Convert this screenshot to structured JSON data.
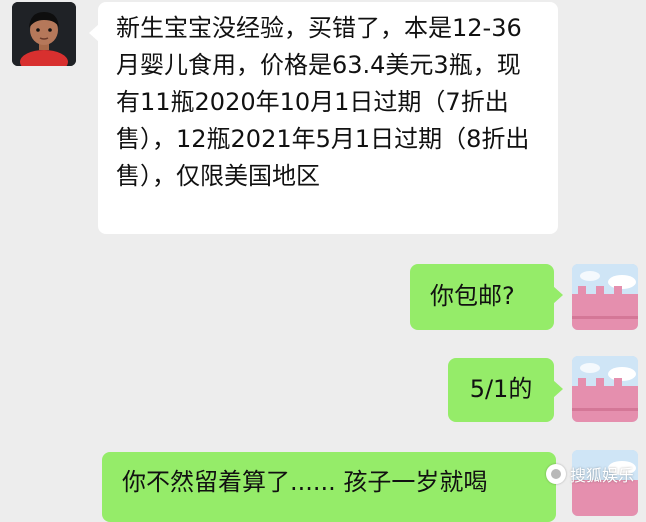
{
  "chat": {
    "messages": [
      {
        "sender": "other",
        "text": "新生宝宝没经验，买错了，本是12-36月婴儿食用，价格是63.4美元3瓶，现有11瓶2020年10月1日过期（7折出售），12瓶2021年5月1日过期（8折出售），仅限美国地区"
      },
      {
        "sender": "me",
        "text": "你包邮?"
      },
      {
        "sender": "me",
        "text": "5/1的"
      },
      {
        "sender": "me",
        "text": "你不然留着算了...... 孩子一岁就喝"
      }
    ]
  },
  "watermark": {
    "text": "搜狐娱乐"
  },
  "colors": {
    "background": "#ededed",
    "bubble_other": "#ffffff",
    "bubble_me": "#95ec69"
  }
}
